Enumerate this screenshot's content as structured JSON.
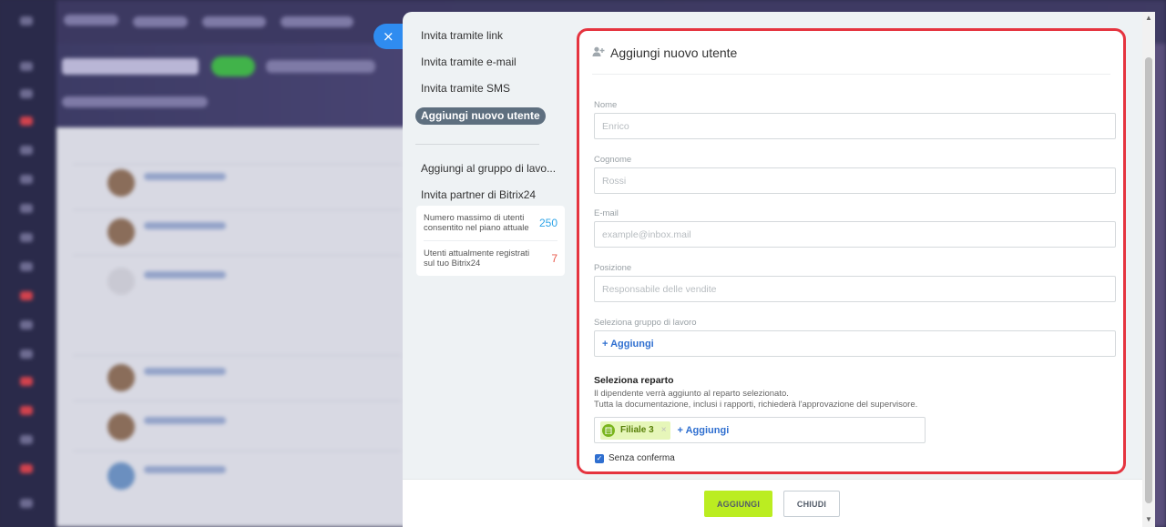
{
  "close_glyph": "×",
  "nav": {
    "items": [
      {
        "label": "Invita tramite link"
      },
      {
        "label": "Invita tramite e-mail"
      },
      {
        "label": "Invita tramite SMS"
      },
      {
        "label": "Aggiungi nuovo utente"
      }
    ],
    "items2": [
      {
        "label": "Aggiungi al gruppo di lavo..."
      },
      {
        "label": "Invita partner di Bitrix24"
      }
    ]
  },
  "stats": [
    {
      "label": "Numero massimo di utenti consentito nel piano attuale",
      "value": "250",
      "color": "#2fa4e7"
    },
    {
      "label": "Utenti attualmente registrati sul tuo Bitrix24",
      "value": "7",
      "color": "#e8584a"
    }
  ],
  "form": {
    "title": "Aggiungi nuovo utente",
    "title_icon": "add-user-icon",
    "fields": {
      "nome": {
        "label": "Nome",
        "placeholder": "Enrico"
      },
      "cognome": {
        "label": "Cognome",
        "placeholder": "Rossi"
      },
      "email": {
        "label": "E-mail",
        "placeholder": "example@inbox.mail"
      },
      "posizione": {
        "label": "Posizione",
        "placeholder": "Responsabile delle vendite"
      },
      "gruppo": {
        "label": "Seleziona gruppo di lavoro",
        "add_label": "+ Aggiungi"
      }
    },
    "reparto": {
      "title": "Seleziona reparto",
      "desc1": "Il dipendente verrà aggiunto al reparto selezionato.",
      "desc2": "Tutta la documentazione, inclusi i rapporti, richiederà l'approvazione del supervisore.",
      "tag": "Filiale 3",
      "add_label": "+ Aggiungi"
    },
    "checkbox_label": "Senza conferma",
    "checkbox_checked": true
  },
  "footer": {
    "add_label": "AGGIUNGI",
    "close_label": "CHIUDI"
  },
  "colors": {
    "accent_green": "#bbed21",
    "highlight_red": "#e5343f",
    "link_blue": "#2f6fd0"
  }
}
